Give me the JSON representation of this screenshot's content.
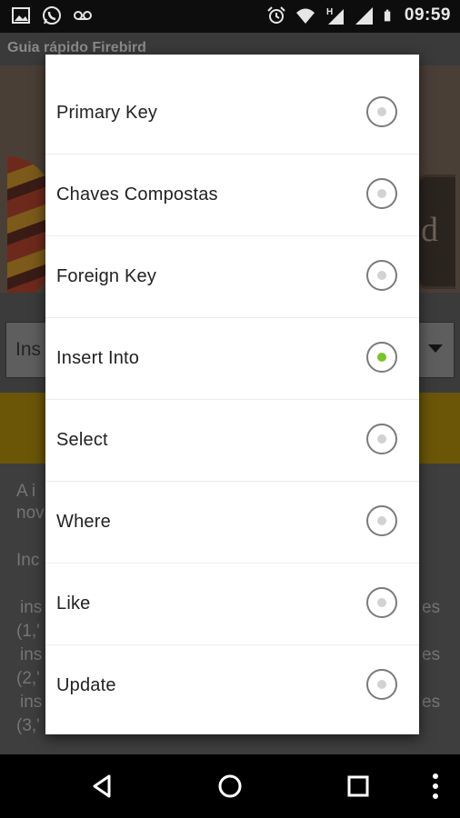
{
  "status_bar": {
    "time": "09:59",
    "left_icons": [
      "image-icon",
      "whatsapp-icon",
      "voicemail-icon"
    ],
    "right_icons": [
      "alarm-icon",
      "wifi-icon",
      "h-signal-icon",
      "signal-icon",
      "signal-icon-2",
      "battery-icon"
    ]
  },
  "app": {
    "title": "Guia rápido Firebird",
    "hero_sign_text": "d",
    "spinner_text": "Ins",
    "body_lines": [
      "A i",
      "nov",
      "Inc",
      "ins",
      "(1,'",
      "ins",
      "(2,'",
      "ins",
      "(3,'"
    ],
    "body_right": [
      "es",
      "es",
      "es"
    ]
  },
  "dialog": {
    "options": [
      {
        "label": "Primary Key",
        "checked": false
      },
      {
        "label": "Chaves Compostas",
        "checked": false
      },
      {
        "label": "Foreign Key",
        "checked": false
      },
      {
        "label": "Insert Into",
        "checked": true
      },
      {
        "label": "Select",
        "checked": false
      },
      {
        "label": "Where",
        "checked": false
      },
      {
        "label": "Like",
        "checked": false
      },
      {
        "label": "Update",
        "checked": false
      }
    ],
    "checked_color": "#7bc42b"
  },
  "nav": {
    "buttons": [
      "back-icon",
      "home-icon",
      "recents-icon",
      "overflow-menu-icon"
    ]
  }
}
